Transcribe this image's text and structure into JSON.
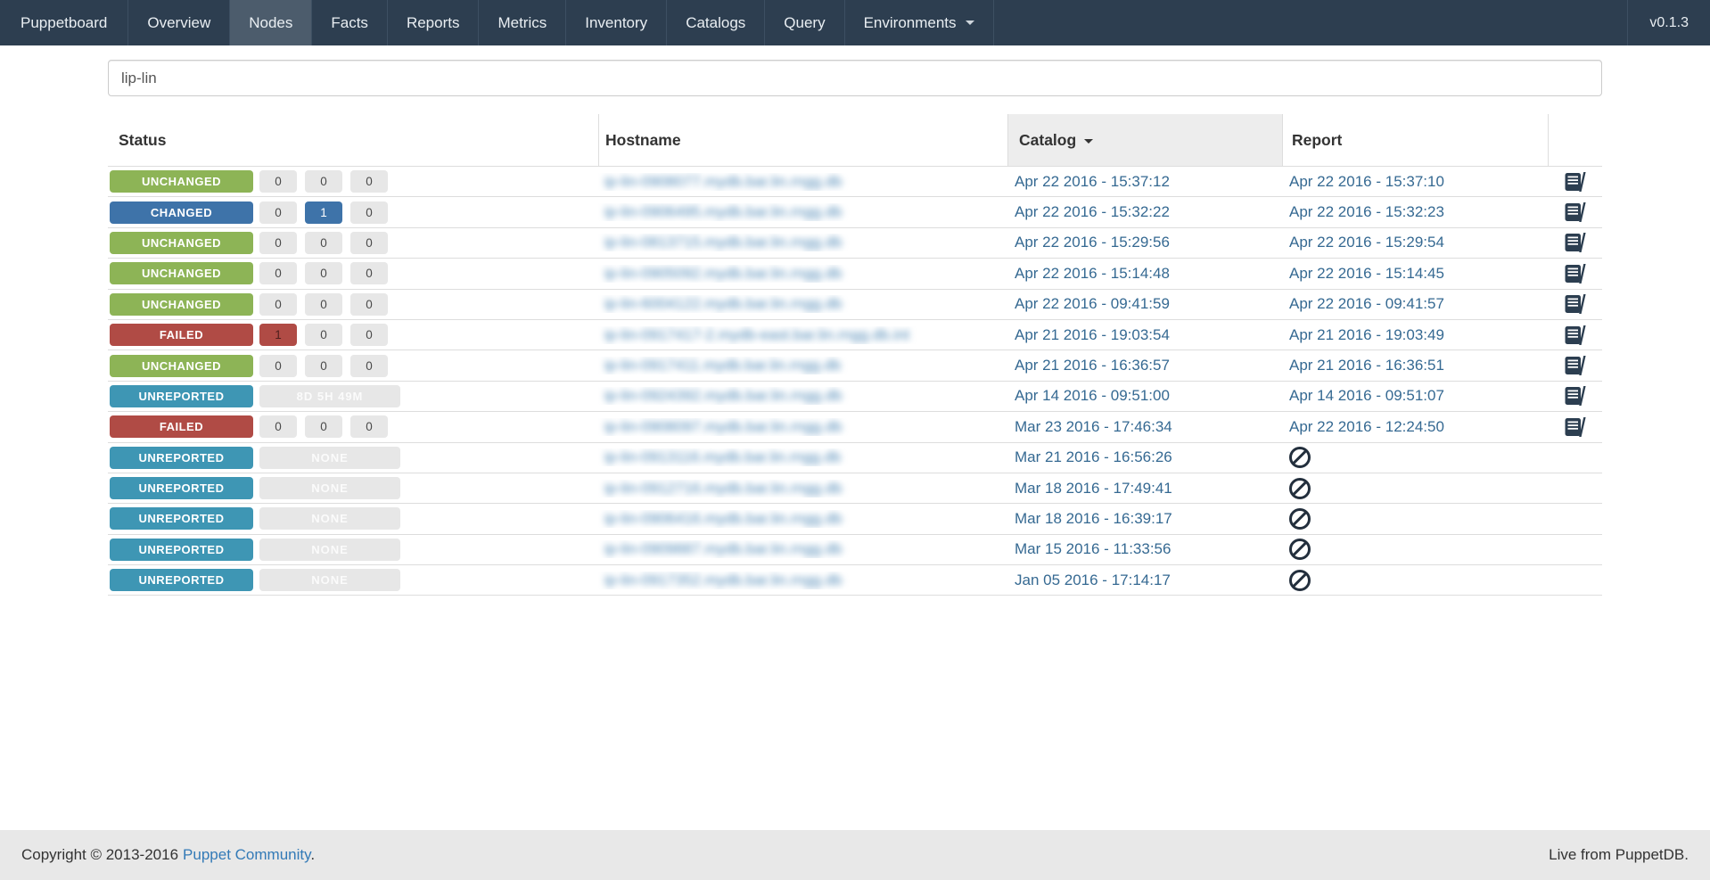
{
  "colors": {
    "navbar_bg": "#2d3e50",
    "navbar_active_bg": "#4c5c6c",
    "navbar_text": "#e9eef2",
    "unchanged": "#8db456",
    "changed": "#3e73a9",
    "failed": "#b04b45",
    "unreported": "#3e96b4",
    "counter_bg": "#e7e7e7",
    "link": "#356992",
    "icon_dark": "#2c3e50",
    "row_border": "#dddddd",
    "catalog_header_bg": "#ededed",
    "footer_bg": "#e8e8e8"
  },
  "navbar": {
    "brand": "Puppetboard",
    "items": [
      {
        "label": "Overview",
        "active": false
      },
      {
        "label": "Nodes",
        "active": true
      },
      {
        "label": "Facts",
        "active": false
      },
      {
        "label": "Reports",
        "active": false
      },
      {
        "label": "Metrics",
        "active": false
      },
      {
        "label": "Inventory",
        "active": false
      },
      {
        "label": "Catalogs",
        "active": false
      },
      {
        "label": "Query",
        "active": false
      },
      {
        "label": "Environments",
        "active": false,
        "dropdown": true
      }
    ],
    "version": "v0.1.3"
  },
  "search": {
    "value": "lip-lin"
  },
  "table": {
    "columns": {
      "status": "Status",
      "hostname": "Hostname",
      "catalog": "Catalog",
      "report": "Report"
    },
    "sorted_by": "catalog",
    "sort_direction": "desc",
    "rows": [
      {
        "status": "UNCHANGED",
        "status_key": "unchanged",
        "counters": [
          {
            "value": "0"
          },
          {
            "value": "0"
          },
          {
            "value": "0"
          }
        ],
        "hostname": {
          "text": "ip-lin-0908077.mydb.bar.lin.rngg.db",
          "blurred": true
        },
        "catalog": "Apr 22 2016 - 15:37:12",
        "report": "Apr 22 2016 - 15:37:10",
        "report_icon": "book"
      },
      {
        "status": "CHANGED",
        "status_key": "changed",
        "counters": [
          {
            "value": "0"
          },
          {
            "value": "1",
            "style": "changed"
          },
          {
            "value": "0"
          }
        ],
        "hostname": {
          "text": "ip-lin-0906495.mydb.bar.lin.rngg.db",
          "blurred": true
        },
        "catalog": "Apr 22 2016 - 15:32:22",
        "report": "Apr 22 2016 - 15:32:23",
        "report_icon": "book"
      },
      {
        "status": "UNCHANGED",
        "status_key": "unchanged",
        "counters": [
          {
            "value": "0"
          },
          {
            "value": "0"
          },
          {
            "value": "0"
          }
        ],
        "hostname": {
          "text": "ip-lin-0813715.mydb.bar.lin.rngg.db",
          "blurred": true
        },
        "catalog": "Apr 22 2016 - 15:29:56",
        "report": "Apr 22 2016 - 15:29:54",
        "report_icon": "book"
      },
      {
        "status": "UNCHANGED",
        "status_key": "unchanged",
        "counters": [
          {
            "value": "0"
          },
          {
            "value": "0"
          },
          {
            "value": "0"
          }
        ],
        "hostname": {
          "text": "ip-lin-0905092.mydb.bar.lin.rngg.db",
          "blurred": true
        },
        "catalog": "Apr 22 2016 - 15:14:48",
        "report": "Apr 22 2016 - 15:14:45",
        "report_icon": "book"
      },
      {
        "status": "UNCHANGED",
        "status_key": "unchanged",
        "counters": [
          {
            "value": "0"
          },
          {
            "value": "0"
          },
          {
            "value": "0"
          }
        ],
        "hostname": {
          "text": "ip-lin-6004122.mydb.bar.lin.rngg.db",
          "blurred": true
        },
        "catalog": "Apr 22 2016 - 09:41:59",
        "report": "Apr 22 2016 - 09:41:57",
        "report_icon": "book"
      },
      {
        "status": "FAILED",
        "status_key": "failed",
        "counters": [
          {
            "value": "1",
            "style": "failed"
          },
          {
            "value": "0"
          },
          {
            "value": "0"
          }
        ],
        "hostname": {
          "text": "ip-lin-0917417-2.mydb-east.bar.lin.rngg.db.int",
          "blurred": true
        },
        "catalog": "Apr 21 2016 - 19:03:54",
        "report": "Apr 21 2016 - 19:03:49",
        "report_icon": "book"
      },
      {
        "status": "UNCHANGED",
        "status_key": "unchanged",
        "counters": [
          {
            "value": "0"
          },
          {
            "value": "0"
          },
          {
            "value": "0"
          }
        ],
        "hostname": {
          "text": "ip-lin-0917411.mydb.bar.lin.rngg.db",
          "blurred": true
        },
        "catalog": "Apr 21 2016 - 16:36:57",
        "report": "Apr 21 2016 - 16:36:51",
        "report_icon": "book"
      },
      {
        "status": "UNREPORTED",
        "status_key": "unreported",
        "wide_label": "8D 5H 49M",
        "hostname": {
          "text": "ip-lin-0924392.mydb.bar.lin.rngg.db",
          "blurred": true
        },
        "catalog": "Apr 14 2016 - 09:51:00",
        "report": "Apr 14 2016 - 09:51:07",
        "report_icon": "book"
      },
      {
        "status": "FAILED",
        "status_key": "failed",
        "counters": [
          {
            "value": "0"
          },
          {
            "value": "0"
          },
          {
            "value": "0"
          }
        ],
        "hostname": {
          "text": "ip-lin-0908097.mydb.bar.lin.rngg.db",
          "blurred": true
        },
        "catalog": "Mar 23 2016 - 17:46:34",
        "report": "Apr 22 2016 - 12:24:50",
        "report_icon": "book"
      },
      {
        "status": "UNREPORTED",
        "status_key": "unreported",
        "wide_label": "NONE",
        "hostname": {
          "text": "ip-lin-0913116.mydb.bar.lin.rngg.db",
          "blurred": true
        },
        "catalog": "Mar 21 2016 - 16:56:26",
        "report": null,
        "report_icon": "none"
      },
      {
        "status": "UNREPORTED",
        "status_key": "unreported",
        "wide_label": "NONE",
        "hostname": {
          "text": "ip-lin-0912716.mydb.bar.lin.rngg.db",
          "blurred": true
        },
        "catalog": "Mar 18 2016 - 17:49:41",
        "report": null,
        "report_icon": "none"
      },
      {
        "status": "UNREPORTED",
        "status_key": "unreported",
        "wide_label": "NONE",
        "hostname": {
          "text": "ip-lin-0906416.mydb.bar.lin.rngg.db",
          "blurred": true
        },
        "catalog": "Mar 18 2016 - 16:39:17",
        "report": null,
        "report_icon": "none"
      },
      {
        "status": "UNREPORTED",
        "status_key": "unreported",
        "wide_label": "NONE",
        "hostname": {
          "text": "ip-lin-0909887.mydb.bar.lin.rngg.db",
          "blurred": true
        },
        "catalog": "Mar 15 2016 - 11:33:56",
        "report": null,
        "report_icon": "none"
      },
      {
        "status": "UNREPORTED",
        "status_key": "unreported",
        "wide_label": "NONE",
        "hostname": {
          "text": "ip-lin-0917352.mydb.bar.lin.rngg.db",
          "blurred": true
        },
        "catalog": "Jan 05 2016 - 17:14:17",
        "report": null,
        "report_icon": "none"
      }
    ]
  },
  "footer": {
    "copyright_prefix": "Copyright © 2013-2016",
    "community_link": "Puppet Community",
    "suffix": ".",
    "live_text": "Live from PuppetDB."
  }
}
